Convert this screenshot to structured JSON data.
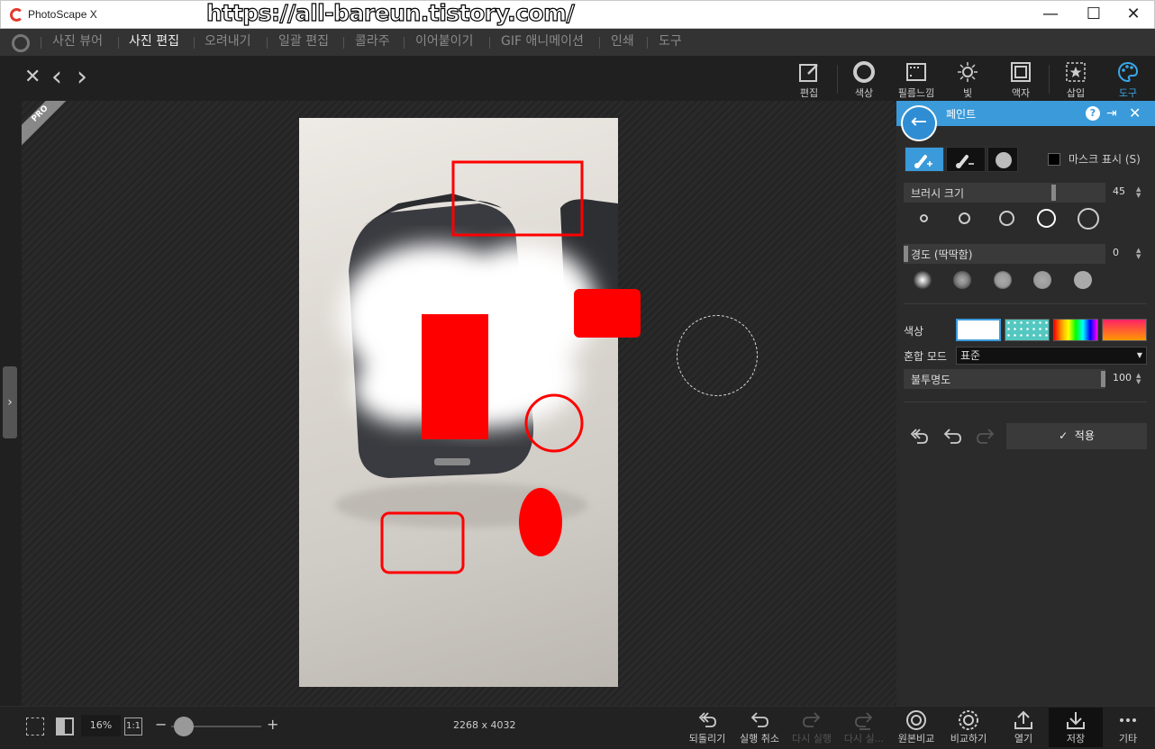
{
  "window": {
    "title": "PhotoScape X",
    "watermark": "https://all-bareun.tistory.com/",
    "minimize": "—",
    "maximize": "☐",
    "close": "✕"
  },
  "menu": {
    "items": [
      "사진 뷰어",
      "사진 편집",
      "오려내기",
      "일괄 편집",
      "콜라주",
      "이어붙이기",
      "GIF 애니메이션",
      "인쇄",
      "도구"
    ],
    "active": "사진 편집"
  },
  "nav": {
    "close": "✕",
    "prev": "‹",
    "next": "›"
  },
  "tools": {
    "edit": "편집",
    "color": "색상",
    "film": "필름느낌",
    "light": "빛",
    "frame": "액자",
    "insert": "삽입",
    "tools": "도구"
  },
  "badge": {
    "text": "PRO"
  },
  "panel": {
    "title": "페인트",
    "mask_label": "마스크 표시 (S)",
    "brush_size_label": "브러시 크기",
    "brush_size_value": "45",
    "brush_size_level": 0.7,
    "hardness_label": "경도 (딱딱함)",
    "hardness_value": "0",
    "color_label": "색상",
    "blend_label": "혼합 모드",
    "blend_value": "표준",
    "opacity_label": "불투명도",
    "opacity_value": "100",
    "apply_label": "적용",
    "colors": {
      "accent": "#3b9ad9",
      "paint": "#ff0000"
    }
  },
  "bottom": {
    "zoom": "16%",
    "zoom_one": "1:1",
    "zoom_minus": "−",
    "zoom_plus": "+",
    "dimensions": "2268 x 4032",
    "buttons": {
      "revert": "되돌리기",
      "undo": "실행 취소",
      "redo": "다시 실행",
      "redo_all": "다시 실...",
      "original": "원본비교",
      "compare": "비교하기",
      "open": "열기",
      "save": "저장",
      "more": "기타"
    }
  }
}
